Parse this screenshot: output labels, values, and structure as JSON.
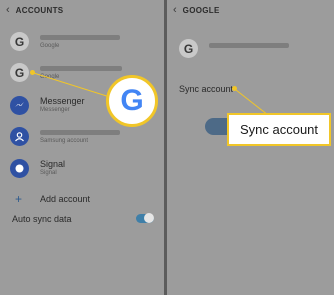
{
  "left": {
    "title": "ACCOUNTS",
    "accounts": [
      {
        "name": "",
        "type": "Google",
        "icon": "google-g-icon"
      },
      {
        "name": "",
        "type": "Google",
        "icon": "google-g-icon"
      },
      {
        "name": "Messenger",
        "type": "Messenger",
        "icon": "messenger-icon"
      },
      {
        "name": "",
        "type": "Samsung account",
        "icon": "samsung-account-icon"
      },
      {
        "name": "Signal",
        "type": "Signal",
        "icon": "signal-icon"
      }
    ],
    "add_account": "Add account",
    "auto_sync": "Auto sync data",
    "auto_sync_on": true
  },
  "right": {
    "title": "GOOGLE",
    "sync_account": "Sync account"
  },
  "callout": {
    "sync_label": "Sync account",
    "accent_color": "#f1c628"
  },
  "icons": {
    "google": "G",
    "back": "‹",
    "plus": "+"
  }
}
